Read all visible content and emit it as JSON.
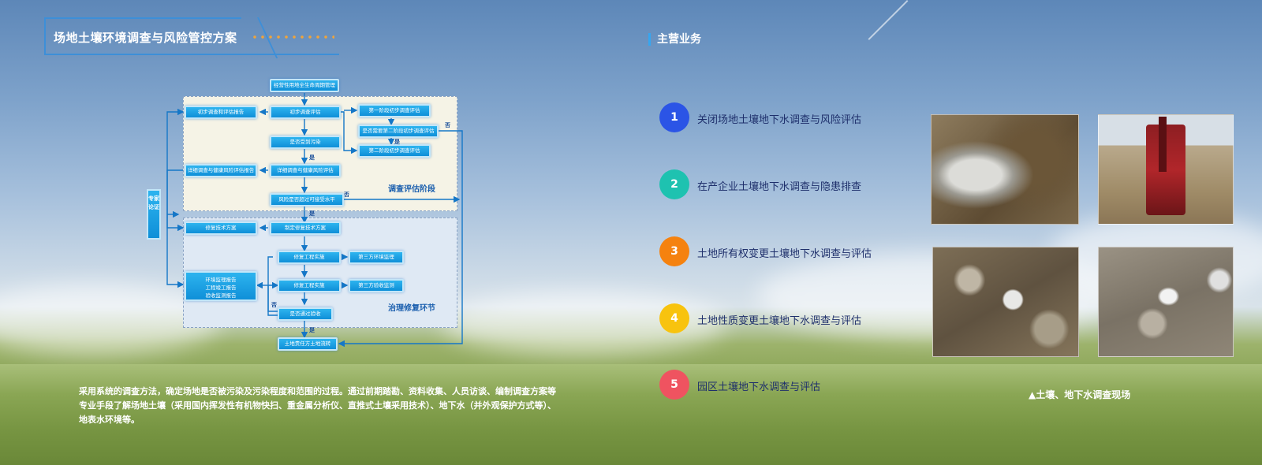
{
  "header": {
    "title": "场地土壤环境调查与风险管控方案"
  },
  "flowchart": {
    "expert_label": "专家论证",
    "stage_labels": {
      "investigation": "调查评估阶段",
      "remediation": "治理修复环节"
    },
    "nodes": {
      "lifecycle": "经营性用地全生命周期管理",
      "prelim_eval": "初步调查评估",
      "prelim_report": "初步调查和评估报告",
      "phase1": "第一阶段初步调查评估",
      "need_phase2": "是否需要第二阶段初步调查评估",
      "phase2": "第二阶段初步调查评估",
      "polluted": "是否受到污染",
      "detailed_eval": "详细调查与健康风险评估",
      "detailed_report": "详细调查与健康风险评估报告",
      "risk_check": "风险是否超过可接受水平",
      "make_plan": "制定修复技术方案",
      "plan": "修复技术方案",
      "work_1": "修复工程实施",
      "env_monitor": "第三方环境监理",
      "work_2": "修复工程实施",
      "acceptance_monitor": "第三方验收监测",
      "passed": "是否通过验收",
      "reports": "环境监理报告\n工程竣工报告\n验收监测报告",
      "transfer": "土地责任方土地流转"
    },
    "edge_labels": {
      "no_top": "否",
      "yes_phase2": "是",
      "yes_polluted": "是",
      "no_risk": "否",
      "yes_risk": "是",
      "no_pass": "否",
      "yes_pass": "是"
    }
  },
  "description": "采用系统的调查方法，确定场地是否被污染及污染程度和范围的过程。通过前期踏勘、资料收集、人员访谈、编制调查方案等专业手段了解场地土壤（采用国内挥发性有机物快扫、重金属分析仪、直推式土壤采用技术）、地下水（并外观保护方式等）、地表水环境等。",
  "business": {
    "title": "主营业务",
    "items": [
      {
        "num": "1",
        "label": "关闭场地土壤地下水调查与风险评估",
        "color": "#2b54e6"
      },
      {
        "num": "2",
        "label": "在产企业土壤地下水调查与隐患排查",
        "color": "#1ec2b0"
      },
      {
        "num": "3",
        "label": "土地所有权变更土壤地下水调查与评估",
        "color": "#f5820f"
      },
      {
        "num": "4",
        "label": "土地性质变更土壤地下水调查与评估",
        "color": "#f8c30e"
      },
      {
        "num": "5",
        "label": "园区土壤地下水调查与评估",
        "color": "#ef5360"
      }
    ]
  },
  "photos": {
    "caption": "▲土壤、地下水调查现场"
  },
  "colors": {
    "accent": "#3d8fd8",
    "node": "#1aa3e5",
    "dots": "#f0a43a"
  }
}
